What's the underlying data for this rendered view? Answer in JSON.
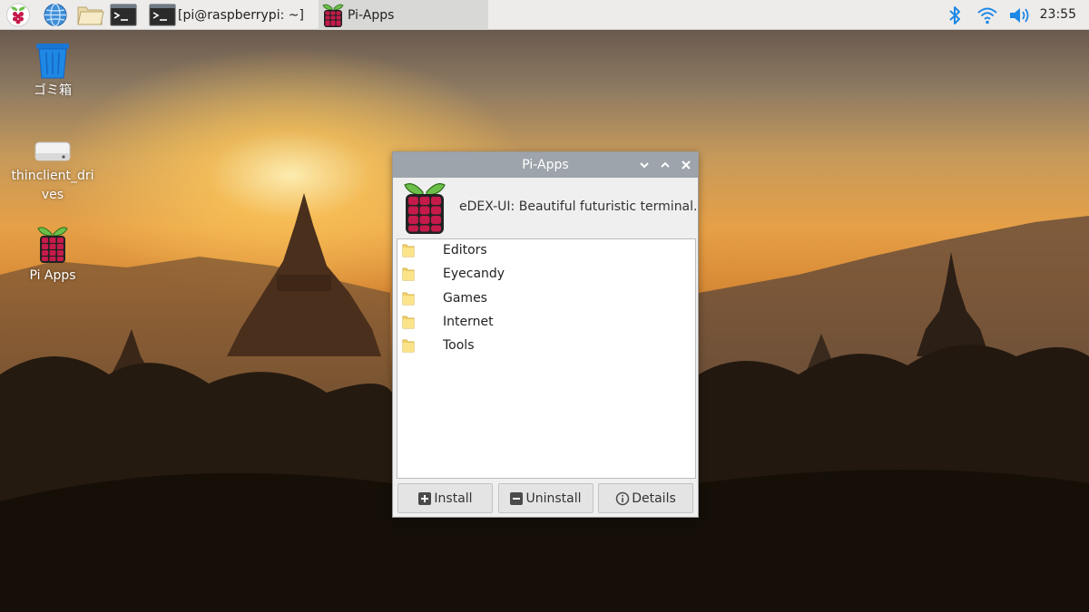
{
  "taskbar": {
    "tasks": [
      {
        "label": "[pi@raspberrypi: ~]"
      },
      {
        "label": "Pi-Apps"
      }
    ],
    "clock": "23:55",
    "launchers": [
      "raspberry-menu-icon",
      "web-browser-icon",
      "file-manager-icon",
      "terminal-icon"
    ],
    "tray": [
      "bluetooth-icon",
      "wifi-icon",
      "volume-icon"
    ]
  },
  "desktop": {
    "icons": [
      {
        "label": "ゴミ箱",
        "icon": "trash-icon"
      },
      {
        "label": "thinclient_drives",
        "icon": "drive-icon"
      },
      {
        "label": "Pi Apps",
        "icon": "raspberry-icon"
      }
    ]
  },
  "window": {
    "title": "Pi-Apps",
    "description": "eDEX-UI: Beautiful futuristic terminal.",
    "categories": [
      "Editors",
      "Eyecandy",
      "Games",
      "Internet",
      "Tools"
    ],
    "buttons": {
      "install": "Install",
      "uninstall": "Uninstall",
      "details": "Details"
    }
  },
  "colors": {
    "titlebar": "#9da4ab",
    "taskbar": "#edeceb",
    "raspberry_red": "#c51a4a",
    "leaf_green": "#6cc04a",
    "accent_blue": "#1e88e5"
  }
}
